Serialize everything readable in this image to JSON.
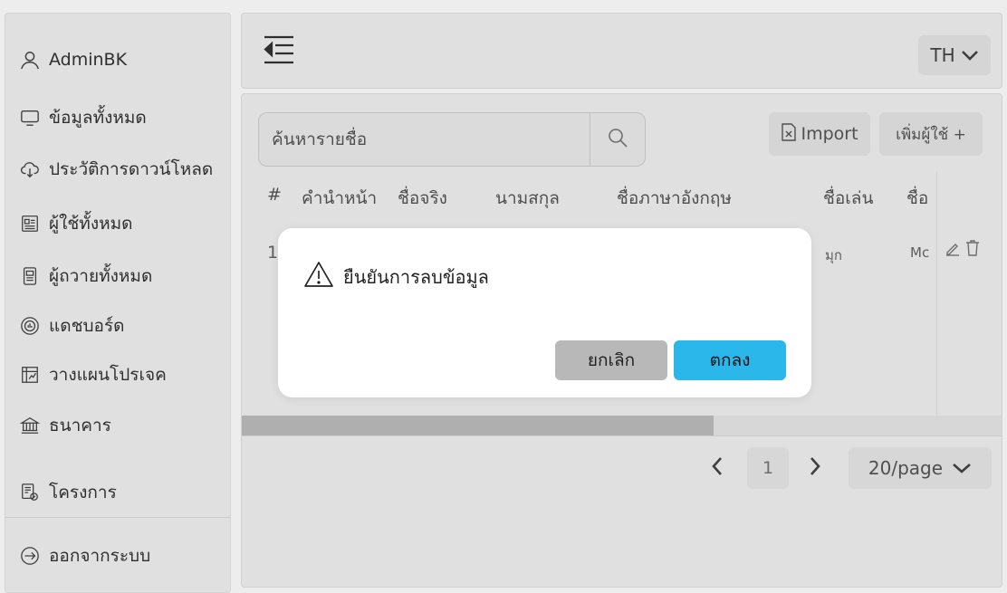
{
  "sidebar": {
    "user": {
      "name": "AdminBK",
      "icon": "user-icon"
    },
    "items": [
      {
        "label": "ข้อมูลทั้งหมด",
        "icon": "monitor-icon"
      },
      {
        "label": "ประวัติการดาวน์โหลด",
        "icon": "cloud-download-icon"
      },
      {
        "label": "ผู้ใช้ทั้งหมด",
        "icon": "id-card-icon"
      },
      {
        "label": "ผู้ถวายทั้งหมด",
        "icon": "document-icon"
      },
      {
        "label": "แดชบอร์ด",
        "icon": "dashboard-icon"
      },
      {
        "label": "วางแผนโปรเจค",
        "icon": "project-plan-icon"
      },
      {
        "label": "ธนาคาร",
        "icon": "bank-icon"
      },
      {
        "label": "โครงการ",
        "icon": "project-icon"
      }
    ],
    "logout": {
      "label": "ออกจากระบบ",
      "icon": "logout-arrow-icon"
    }
  },
  "topbar": {
    "language": "TH"
  },
  "toolbar": {
    "search_placeholder": "ค้นหารายชื่อ",
    "import_label": "Import",
    "add_user_label": "เพิ่มผู้ใช้ +"
  },
  "table": {
    "columns": [
      "#",
      "คำนำหน้า",
      "ชื่อจริง",
      "นามสกุล",
      "ชื่อภาษาอังกฤษ",
      "ชื่อเล่น",
      "ชื่อ"
    ],
    "rows": [
      {
        "index": "1",
        "nickname": "มุก",
        "col7": "Mc"
      }
    ]
  },
  "pagination": {
    "current_page": "1",
    "page_size": "20/page"
  },
  "scrollbar": {
    "thumb_fraction": 0.62
  },
  "modal": {
    "title": "ยืนยันการลบข้อมูล",
    "cancel_label": "ยกเลิก",
    "ok_label": "ตกลง"
  }
}
